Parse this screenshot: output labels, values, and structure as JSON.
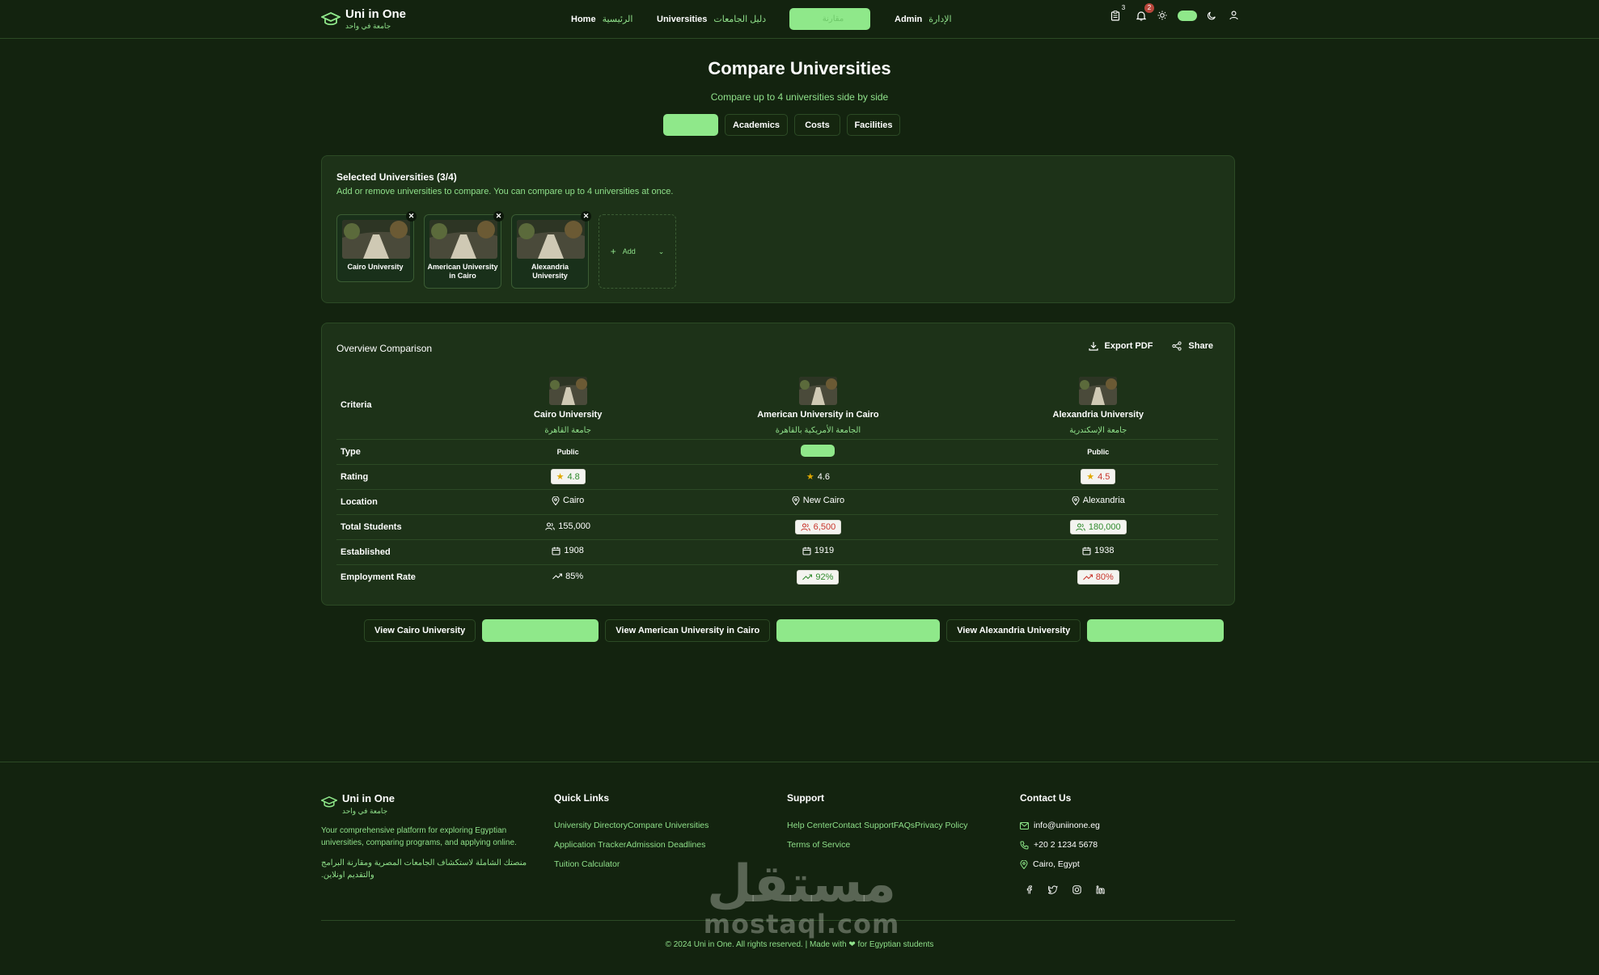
{
  "header": {
    "app_title": "Uni in One",
    "app_subtitle": "جامعة في واحد",
    "nav": [
      {
        "en": "Home",
        "ar": "الرئيسية"
      },
      {
        "en": "Universities",
        "ar": "دليل الجامعات"
      },
      {
        "en": "",
        "ar": "مقارنة"
      },
      {
        "en": "Admin",
        "ar": "الإدارة"
      }
    ],
    "clipboard_count": "3",
    "notification_count": "2"
  },
  "page": {
    "title": "Compare Universities",
    "subtitle": "Compare up to 4 universities side by side",
    "tabs": [
      "",
      "Academics",
      "Costs",
      "Facilities"
    ]
  },
  "selected": {
    "title": "Selected Universities (3/4)",
    "description": "Add or remove universities to compare. You can compare up to 4 universities at once.",
    "chips": [
      "Cairo University",
      "American University in Cairo",
      "Alexandria University"
    ],
    "add_label": "Add",
    "remove_symbol": "✕"
  },
  "overview": {
    "title": "Overview Comparison",
    "export_label": "Export PDF",
    "share_label": "Share",
    "criteria_label": "Criteria",
    "universities": [
      {
        "en": "Cairo University",
        "ar": "جامعة القاهرة"
      },
      {
        "en": "American University in Cairo",
        "ar": "الجامعة الأمريكية بالقاهرة"
      },
      {
        "en": "Alexandria University",
        "ar": "جامعة الإسكندرية"
      }
    ],
    "rows": {
      "type": {
        "label": "Type",
        "values": [
          "Public",
          "",
          "Public"
        ]
      },
      "rating": {
        "label": "Rating",
        "values": [
          "4.8",
          "4.6",
          "4.5"
        ]
      },
      "location": {
        "label": "Location",
        "values": [
          "Cairo",
          "New Cairo",
          "Alexandria"
        ]
      },
      "students": {
        "label": "Total Students",
        "values": [
          "155,000",
          "6,500",
          "180,000"
        ]
      },
      "established": {
        "label": "Established",
        "values": [
          "1908",
          "1919",
          "1938"
        ]
      },
      "employment": {
        "label": "Employment Rate",
        "values": [
          "85%",
          "92%",
          "80%"
        ]
      }
    }
  },
  "view_buttons": [
    "View Cairo University",
    "View American University in Cairo",
    "View Alexandria University"
  ],
  "footer": {
    "app_title": "Uni in One",
    "app_subtitle": "جامعة في واحد",
    "desc_en": "Your comprehensive platform for exploring Egyptian universities, comparing programs, and applying online.",
    "desc_ar": "منصتك الشاملة لاستكشاف الجامعات المصرية ومقارنة البرامج والتقديم اونلاين.",
    "quick_links_title": "Quick Links",
    "quick_links": [
      "University DirectoryCompare Universities",
      "Application TrackerAdmission Deadlines",
      "Tuition Calculator"
    ],
    "support_title": "Support",
    "support_links": [
      "Help CenterContact SupportFAQsPrivacy Policy",
      "Terms of Service"
    ],
    "contact_title": "Contact Us",
    "email": "info@uniinone.eg",
    "phone": "+20 2 1234 5678",
    "address": "Cairo, Egypt",
    "copyright": "© 2024 Uni in One. All rights reserved. | Made with ❤ for Egyptian students"
  },
  "watermark": {
    "ar": "مستقل",
    "en": "mostaql.com"
  },
  "colors": {
    "background": "#13230f",
    "card": "#1d3218",
    "accent": "#8fe88a",
    "text_accent": "#8fe08a",
    "good": "#2f8a2c",
    "bad": "#c8342a"
  }
}
